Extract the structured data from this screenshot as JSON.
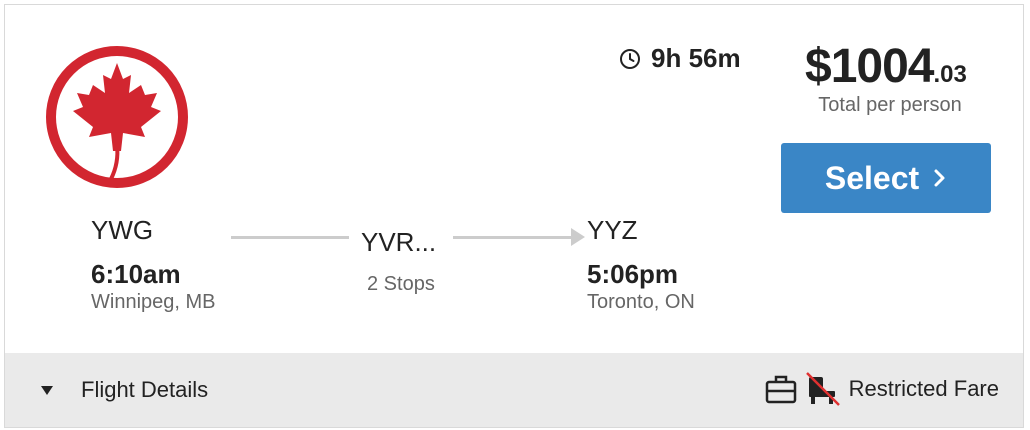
{
  "airline": {
    "logo_icon": "air-canada-maple-leaf-logo",
    "brand_color": "#d22630"
  },
  "duration": {
    "icon": "clock-icon",
    "text": "9h 56m"
  },
  "price": {
    "dollars": "$1004",
    "cents": ".03",
    "subtitle": "Total per person"
  },
  "select_button": {
    "label": "Select",
    "icon": "chevron-right-icon",
    "color": "#3a86c6"
  },
  "departure": {
    "code": "YWG",
    "time": "6:10am",
    "city": "Winnipeg, MB"
  },
  "layover": {
    "code": "YVR...",
    "stops": "2 Stops"
  },
  "arrival": {
    "code": "YYZ",
    "time": "5:06pm",
    "city": "Toronto, ON"
  },
  "footer": {
    "details_label": "Flight Details",
    "details_icon": "caret-down-icon",
    "fare_label": "Restricted Fare",
    "fare_icons": [
      "carry-on-bag-icon",
      "no-seat-selection-icon"
    ]
  }
}
